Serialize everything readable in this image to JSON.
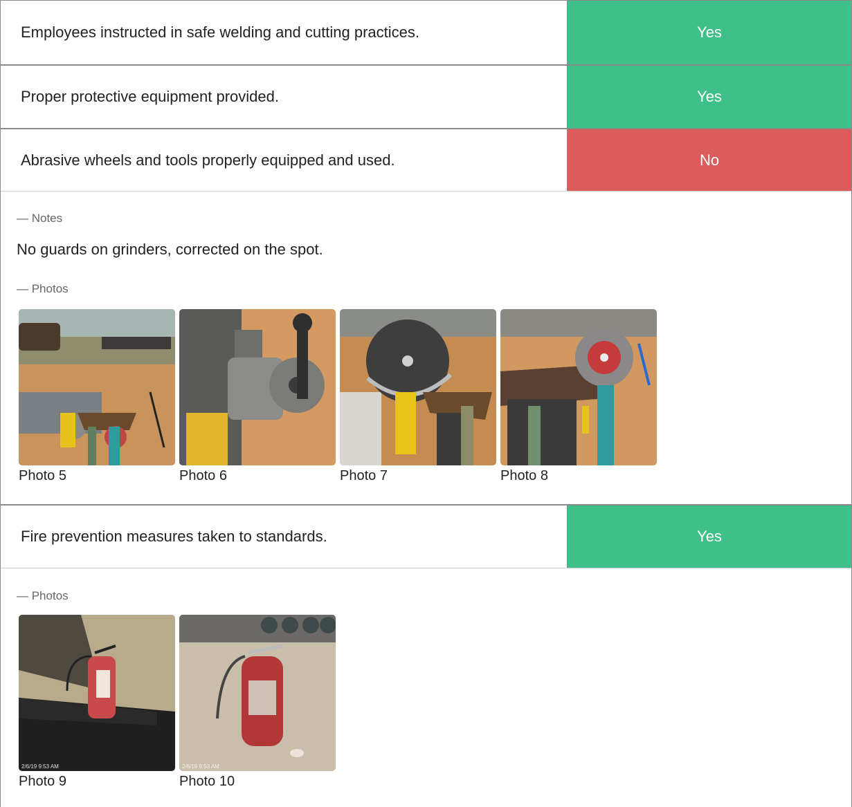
{
  "checklist": [
    {
      "question": "Employees instructed in safe welding and cutting practices.",
      "answer": "Yes",
      "status_color": "#3fbf8a"
    },
    {
      "question": "Proper protective equipment provided.",
      "answer": "Yes",
      "status_color": "#3fbf8a"
    },
    {
      "question": "Abrasive wheels and tools properly equipped and used.",
      "answer": "No",
      "status_color": "#dc5c5c"
    },
    {
      "question": "Fire prevention measures taken to standards.",
      "answer": "Yes",
      "status_color": "#3fbf8a"
    }
  ],
  "abrasive_details": {
    "notes_label": "— Notes",
    "notes_text": "No guards on grinders, corrected on the spot.",
    "photos_label": "— Photos",
    "photos": [
      {
        "caption": "Photo 5",
        "icon": "grinder-photo"
      },
      {
        "caption": "Photo 6",
        "icon": "grinder-photo"
      },
      {
        "caption": "Photo 7",
        "icon": "grinder-photo"
      },
      {
        "caption": "Photo 8",
        "icon": "grinder-photo"
      }
    ]
  },
  "fire_details": {
    "photos_label": "— Photos",
    "photos": [
      {
        "caption": "Photo 9",
        "icon": "fire-extinguisher-photo",
        "stamp": "2/6/19 9:53 AM"
      },
      {
        "caption": "Photo 10",
        "icon": "fire-extinguisher-photo",
        "stamp": "2/6/19 9:53 AM"
      }
    ]
  }
}
